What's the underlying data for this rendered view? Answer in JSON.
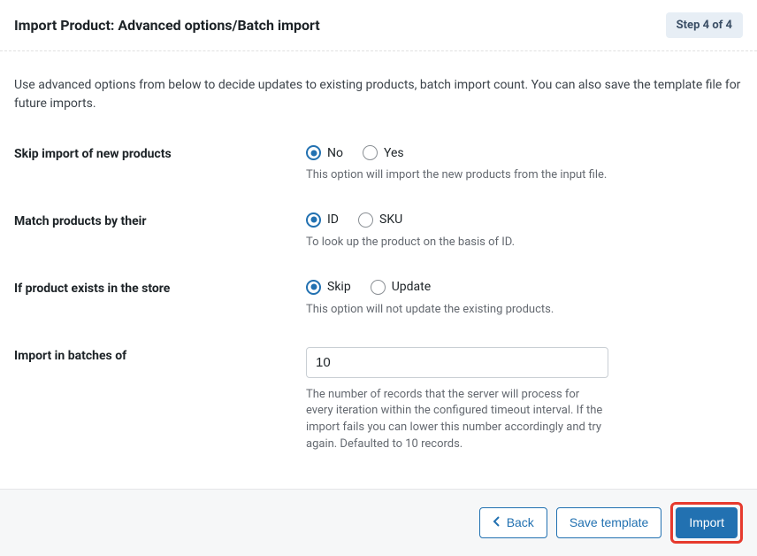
{
  "header": {
    "title": "Import Product: Advanced options/Batch import",
    "step_badge": "Step 4 of 4"
  },
  "intro": "Use advanced options from below to decide updates to existing products, batch import count. You can also save the template file for future imports.",
  "fields": {
    "skip_new": {
      "label": "Skip import of new products",
      "opt_no": "No",
      "opt_yes": "Yes",
      "selected": "no",
      "help": "This option will import the new products from the input file."
    },
    "match_by": {
      "label": "Match products by their",
      "opt_id": "ID",
      "opt_sku": "SKU",
      "selected": "id",
      "help": "To look up the product on the basis of ID."
    },
    "if_exists": {
      "label": "If product exists in the store",
      "opt_skip": "Skip",
      "opt_update": "Update",
      "selected": "skip",
      "help": "This option will not update the existing products."
    },
    "batches": {
      "label": "Import in batches of",
      "value": "10",
      "help": "The number of records that the server will process for every iteration within the configured timeout interval. If the import fails you can lower this number accordingly and try again. Defaulted to 10 records."
    }
  },
  "footer": {
    "back": "Back",
    "save_template": "Save template",
    "import": "Import"
  }
}
